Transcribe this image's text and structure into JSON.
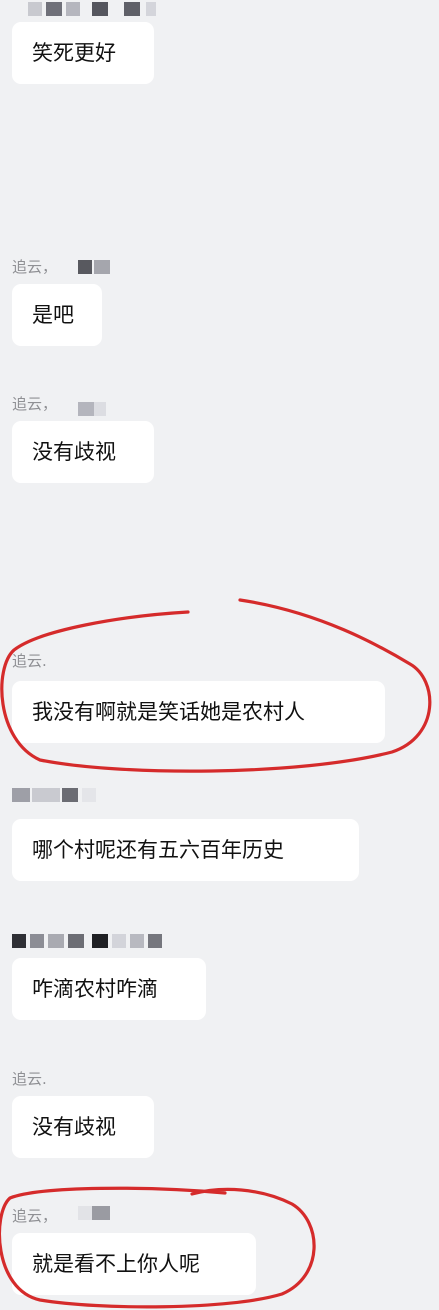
{
  "messages": [
    {
      "sender": "",
      "text": "笑死更好"
    },
    {
      "sender": "追云，",
      "text": "是吧"
    },
    {
      "sender": "追云，",
      "text": "没有歧视"
    },
    {
      "sender": "追云.",
      "text": "我没有啊就是笑话她是农村人"
    },
    {
      "sender": "",
      "text": "哪个村呢还有五六百年历史"
    },
    {
      "sender": "",
      "text": "咋滴农村咋滴"
    },
    {
      "sender": "追云.",
      "text": "没有歧视"
    },
    {
      "sender": "追云，",
      "text": "就是看不上你人呢"
    }
  ],
  "colors": {
    "background": "#f0f1f3",
    "bubble": "#ffffff",
    "sender_text": "#8f9094",
    "message_text": "#111111",
    "annotation_circle": "#d52b2b"
  }
}
